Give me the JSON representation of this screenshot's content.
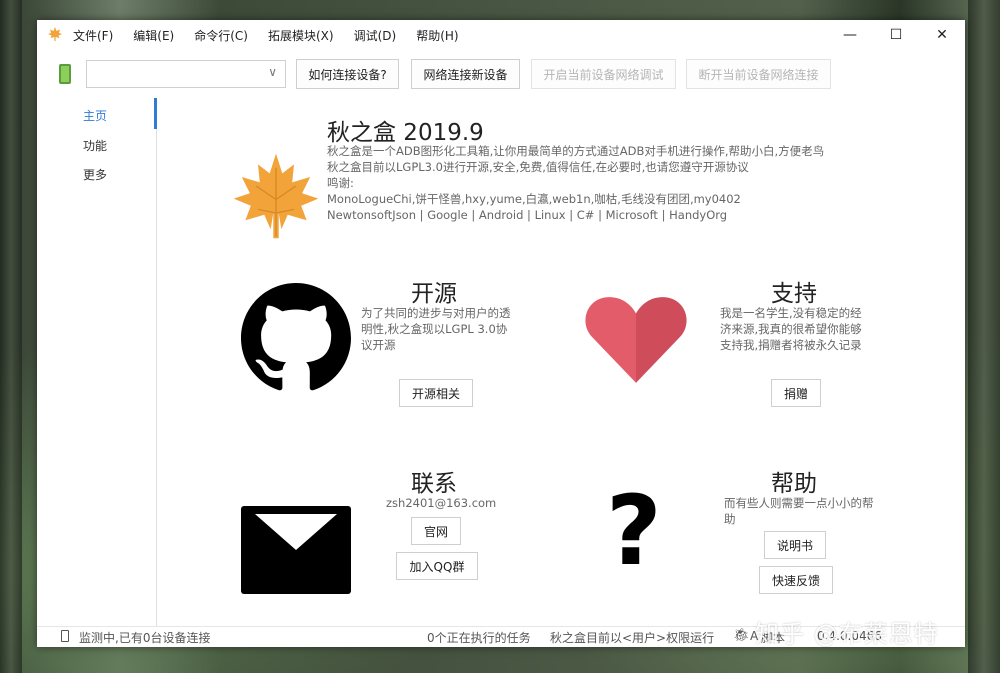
{
  "menu": {
    "items": [
      "文件(F)",
      "编辑(E)",
      "命令行(C)",
      "拓展模块(X)",
      "调试(D)",
      "帮助(H)"
    ]
  },
  "window_controls": {
    "minimize": "—",
    "maximize": "☐",
    "close": "✕"
  },
  "toolbar": {
    "device_select_value": "",
    "how_to_connect": "如何连接设备?",
    "network_connect_new": "网络连接新设备",
    "enable_network_debug": "开启当前设备网络调试",
    "disconnect_network": "断开当前设备网络连接"
  },
  "sidebar": {
    "items": [
      {
        "label": "主页",
        "active": true
      },
      {
        "label": "功能",
        "active": false
      },
      {
        "label": "更多",
        "active": false
      }
    ]
  },
  "about": {
    "title": "秋之盒 2019.9",
    "lines": [
      "秋之盒是一个ADB图形化工具箱,让你用最简单的方式通过ADB对手机进行操作,帮助小白,方便老鸟",
      "秋之盒目前以LGPL3.0进行开源,安全,免费,值得信任,在必要时,也请您遵守开源协议",
      "鸣谢:",
      "MonoLogueChi,饼干怪兽,hxy,yume,白瀛,web1n,咖枯,毛线没有团团,my0402",
      "NewtonsoftJson  | Google | Android | Linux | C# | Microsoft | HandyOrg"
    ]
  },
  "sections": {
    "opensource": {
      "title": "开源",
      "desc": "为了共同的进步与对用户的透明性,秋之盒现以LGPL 3.0协议开源",
      "button": "开源相关"
    },
    "support": {
      "title": "支持",
      "desc": "我是一名学生,没有稳定的经济来源,我真的很希望你能够支持我,捐赠者将被永久记录",
      "button": "捐赠"
    },
    "contact": {
      "title": "联系",
      "email": "zsh2401@163.com",
      "button_site": "官网",
      "button_qq": "加入QQ群"
    },
    "help": {
      "title": "帮助",
      "desc": "而有些人则需要一点小小的帮助",
      "button_manual": "说明书",
      "button_feedback": "快速反馈"
    }
  },
  "statusbar": {
    "monitor": "监测中,已有0台设备连接",
    "tasks": "0个正在执行的任务",
    "permission": "秋之盒目前以<用户>权限运行",
    "android_prefix": "A",
    "android_text": "脚本 ",
    "version": "0.4.0.0466"
  },
  "watermark": "知乎 @布莱恩特",
  "colors": {
    "accent": "#2f7bd6",
    "maple": "#f2a33a",
    "heart_left": "#e35c6a",
    "heart_right": "#cf4c5b"
  }
}
